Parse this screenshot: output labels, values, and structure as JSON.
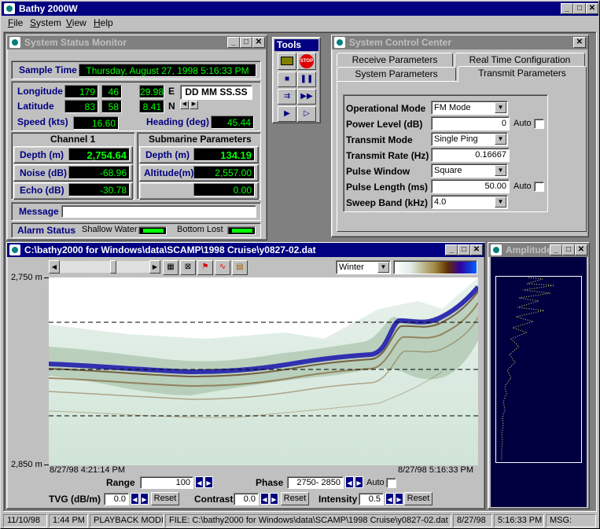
{
  "app": {
    "title": "Bathy 2000W"
  },
  "menu": [
    {
      "label": "File",
      "key": "F",
      "rest": "ile"
    },
    {
      "label": "System",
      "key": "S",
      "rest": "ystem"
    },
    {
      "label": "View",
      "key": "V",
      "rest": "iew"
    },
    {
      "label": "Help",
      "key": "H",
      "rest": "elp"
    }
  ],
  "status_monitor": {
    "title": "System Status Monitor",
    "sample_time_label": "Sample Time",
    "sample_time_value": "Thursday, August 27, 1998   5:16:33 PM",
    "longitude_label": "Longitude",
    "longitude": {
      "deg": "179",
      "min": "46",
      "sec": "29.98",
      "hemi": "E"
    },
    "latitude_label": "Latitude",
    "latitude": {
      "deg": "83",
      "min": "58",
      "sec": "8.41",
      "hemi": "N"
    },
    "format": "DD MM SS.SS",
    "speed_label": "Speed (kts)",
    "speed": "16.60",
    "heading_label": "Heading (deg)",
    "heading": "45.44",
    "channel_header": "Channel 1",
    "sub_header": "Submarine Parameters",
    "depth_label": "Depth (m)",
    "depth": "2,754.64",
    "noise_label": "Noise (dB)",
    "noise": "-68.96",
    "echo_label": "Echo (dB)",
    "echo": "-30.78",
    "sub_depth_label": "Depth (m)",
    "sub_depth": "134.19",
    "altitude_label": "Altitude(m)",
    "altitude": "2,557.00",
    "sub_extra": "0.00",
    "message_label": "Message",
    "message": "",
    "alarm_label": "Alarm Status",
    "shallow_label": "Shallow Water",
    "bottom_lost_label": "Bottom Lost"
  },
  "tools": {
    "title": "Tools",
    "stop_label": "STOP"
  },
  "control_center": {
    "title": "System Control Center",
    "tabs": [
      "Receive Parameters",
      "Real Time Configuration",
      "System Parameters",
      "Transmit Parameters"
    ],
    "active_tab": "Transmit Parameters",
    "fields": {
      "op_mode_label": "Operational Mode",
      "op_mode": "FM Mode",
      "power_label": "Power Level (dB)",
      "power": "0",
      "auto_label": "Auto",
      "tx_mode_label": "Transmit Mode",
      "tx_mode": "Single Ping",
      "tx_rate_label": "Transmit Rate (Hz)",
      "tx_rate": "0.16667",
      "pulse_win_label": "Pulse Window",
      "pulse_win": "Square",
      "pulse_len_label": "Pulse Length (ms)",
      "pulse_len": "50.00",
      "sweep_label": "Sweep Band (kHz)",
      "sweep": "4.0"
    }
  },
  "data_window": {
    "title": "C:\\bathy2000 for Windows\\data\\SCAMP\\1998 Cruise\\y0827-02.dat",
    "palette": "Winter",
    "y_top": "2,750 m",
    "y_bottom": "2,850 m",
    "t_start": "8/27/98  4:21:14 PM",
    "t_end": "8/27/98 5:16:33 PM",
    "range_label": "Range",
    "range": "100",
    "phase_label": "Phase",
    "phase": "2750- 2850",
    "auto_label": "Auto",
    "tvg_label": "TVG (dB/m)",
    "tvg": "0.0",
    "contrast_label": "Contrast",
    "contrast": "0.0",
    "intensity_label": "Intensity",
    "intensity": "0.5",
    "reset_label": "Reset"
  },
  "amplitude": {
    "title": "Amplitude"
  },
  "statusbar": {
    "date": "11/10/98",
    "time": "1:44 PM",
    "mode": "PLAYBACK MODE",
    "file": "FILE:  C:\\bathy2000 for Windows\\data\\SCAMP\\1998 Cruise\\y0827-02.dat",
    "date2": "8/27/98",
    "time2": "5:16:33 PM",
    "msg": "MSG:"
  }
}
